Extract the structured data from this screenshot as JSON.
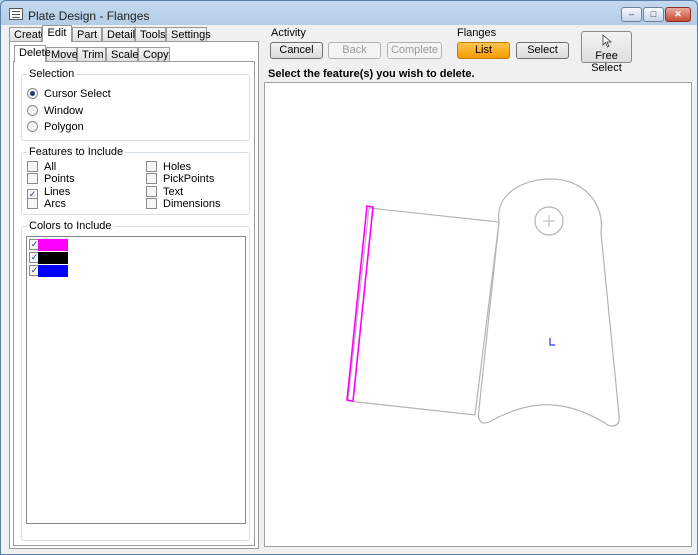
{
  "window": {
    "title": "Plate Design - Flanges"
  },
  "main_tabs": [
    "Create",
    "Edit",
    "Part",
    "Details",
    "Tools",
    "Settings"
  ],
  "main_tab_active": "Edit",
  "sub_tabs": [
    "Delete",
    "Move",
    "Trim",
    "Scale",
    "Copy"
  ],
  "sub_tab_active": "Delete",
  "selection": {
    "title": "Selection",
    "options": [
      {
        "label": "Cursor Select",
        "checked": true
      },
      {
        "label": "Window",
        "checked": false
      },
      {
        "label": "Polygon",
        "checked": false
      }
    ]
  },
  "features": {
    "title": "Features to Include",
    "left": [
      {
        "label": "All",
        "checked": false
      },
      {
        "label": "Points",
        "checked": false
      },
      {
        "label": "Lines",
        "checked": true
      },
      {
        "label": "Arcs",
        "checked": false
      }
    ],
    "right": [
      {
        "label": "Holes",
        "checked": false
      },
      {
        "label": "PickPoints",
        "checked": false
      },
      {
        "label": "Text",
        "checked": false
      },
      {
        "label": "Dimensions",
        "checked": false
      }
    ]
  },
  "colors": {
    "title": "Colors to Include",
    "items": [
      {
        "color": "#ff00ff",
        "checked": true
      },
      {
        "color": "#000000",
        "checked": true
      },
      {
        "color": "#0000ff",
        "checked": true
      }
    ]
  },
  "activity": {
    "title": "Activity",
    "cancel": "Cancel",
    "back": "Back",
    "complete": "Complete"
  },
  "flanges": {
    "title": "Flanges",
    "list": "List",
    "select": "Select"
  },
  "free_select": "Free Select",
  "instruction": "Select the feature(s) you wish to delete.",
  "colors_theme": {
    "highlight": "#ff00ff",
    "outline": "#b4b4b4",
    "accent": "#f59b00"
  }
}
